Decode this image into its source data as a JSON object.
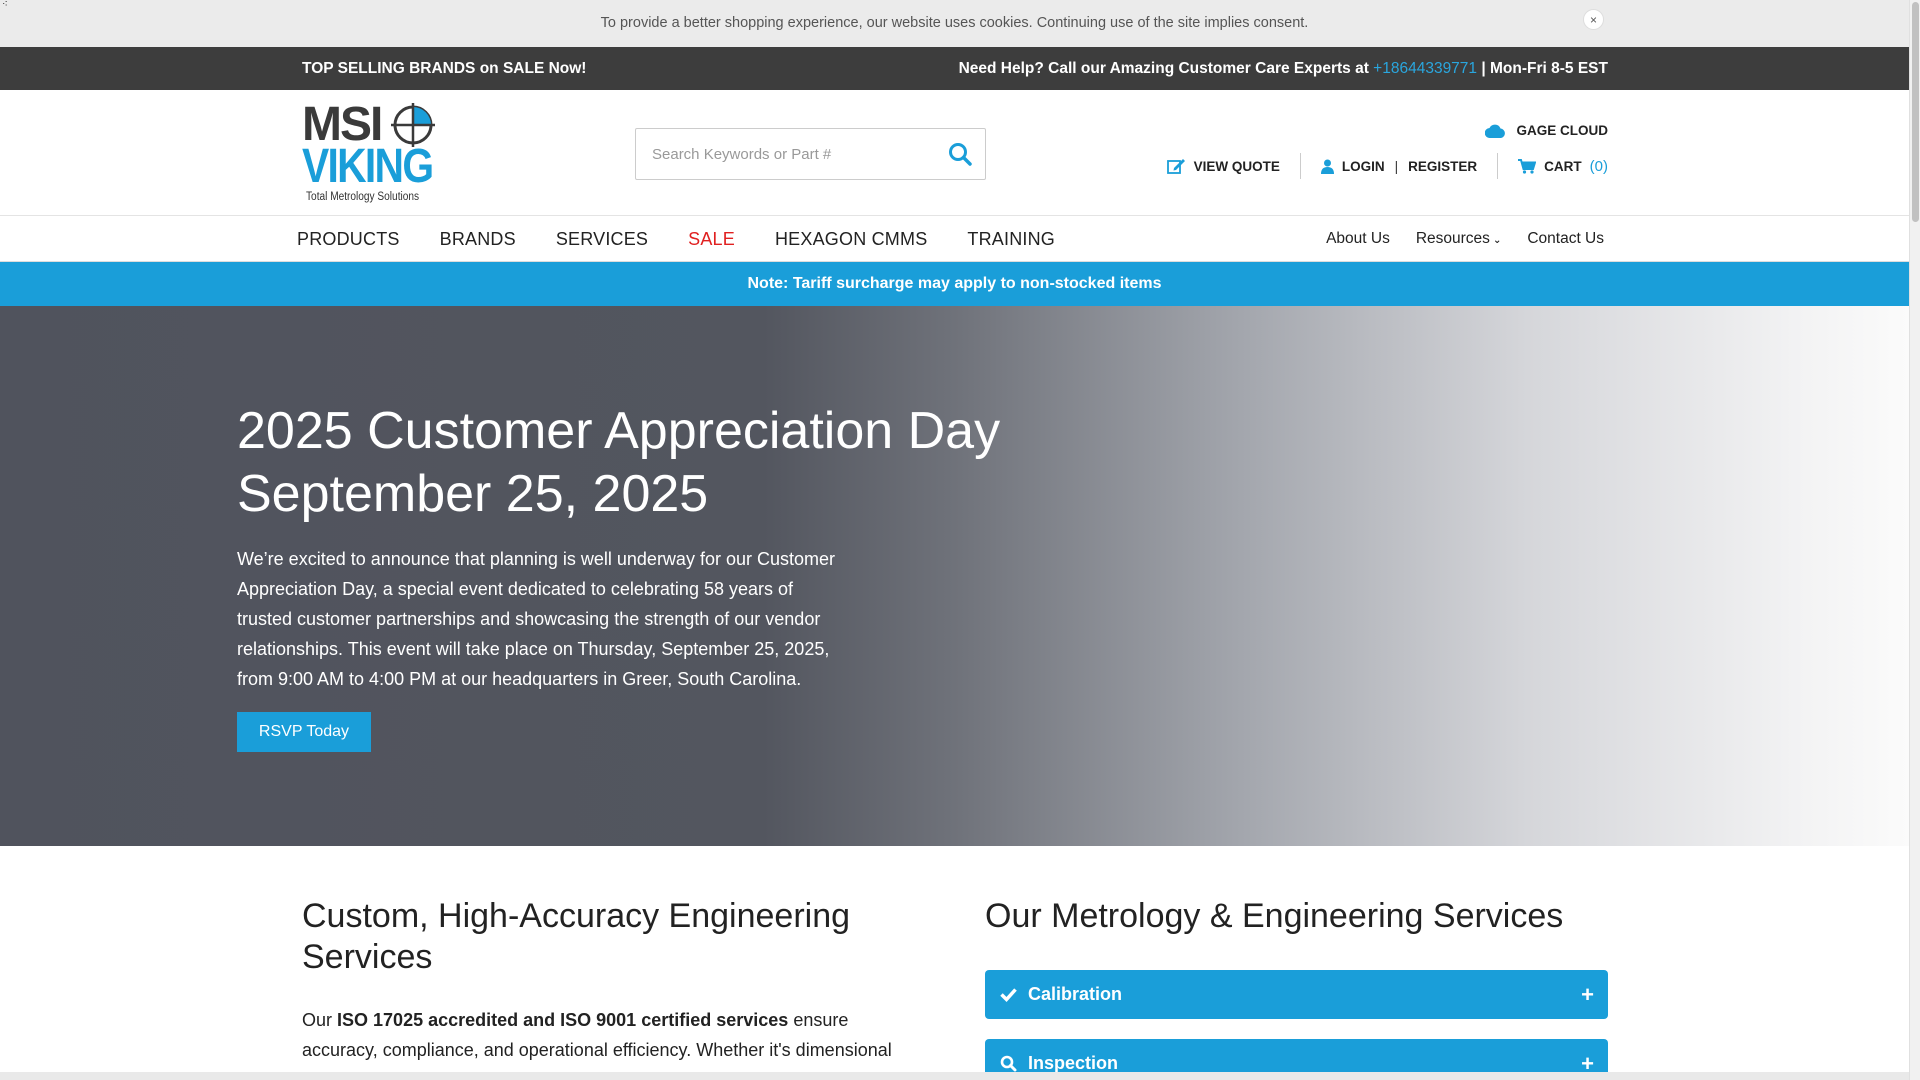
{
  "cookie": {
    "message": "To provide a better shopping experience, our website uses cookies. Continuing use of the site implies consent.",
    "close_label": "×"
  },
  "topbar": {
    "promo": "TOP SELLING BRANDS on SALE Now!",
    "help_prefix": "Need Help? Call our Amazing Customer Care Experts at",
    "phone": "+18644339771",
    "help_suffix": "| Mon-Fri 8-5 EST"
  },
  "logo": {
    "line1": "MSI",
    "line2": "VIKING",
    "tagline": "Total Metrology Solutions"
  },
  "search": {
    "placeholder": "Search Keywords or Part #"
  },
  "header_links": {
    "gage_cloud": "GAGE CLOUD",
    "view_quote": "VIEW QUOTE",
    "login": "LOGIN",
    "separator": "|",
    "register": "REGISTER",
    "cart": "CART",
    "cart_count": "(0)"
  },
  "nav": {
    "main": [
      "PRODUCTS",
      "BRANDS",
      "SERVICES",
      "SALE",
      "HEXAGON CMMS",
      "TRAINING"
    ],
    "about": "About Us",
    "resources": "Resources",
    "contact": "Contact Us"
  },
  "notice": "Note: Tariff surcharge may apply to non-stocked items",
  "hero": {
    "title_line1": "2025 Customer Appreciation Day",
    "title_line2": "September 25, 2025",
    "body": "We’re excited to announce that planning is well underway for our Customer Appreciation Day, a special event dedicated to celebrating 58 years of trusted customer partnerships and showcasing the strength of our vendor relationships. This event will take place on Thursday, September 25, 2025, from 9:00 AM to 4:00 PM at our headquarters in Greer, South Carolina.",
    "cta": "RSVP Today"
  },
  "left_section": {
    "title": "Custom, High-Accuracy Engineering Services",
    "p_prefix": "Our",
    "p_bold": "ISO 17025 accredited and ISO 9001 certified services",
    "p_rest": "ensure accuracy, compliance, and operational efficiency. Whether it's dimensional"
  },
  "right_section": {
    "title": "Our Metrology & Engineering Services",
    "accordion": [
      {
        "label": "Calibration",
        "icon": "check-icon"
      },
      {
        "label": "Inspection",
        "icon": "search-icon"
      }
    ]
  },
  "colors": {
    "accent": "#1a9ed9",
    "topbar": "#3d3d3d",
    "sale": "#e02020"
  }
}
